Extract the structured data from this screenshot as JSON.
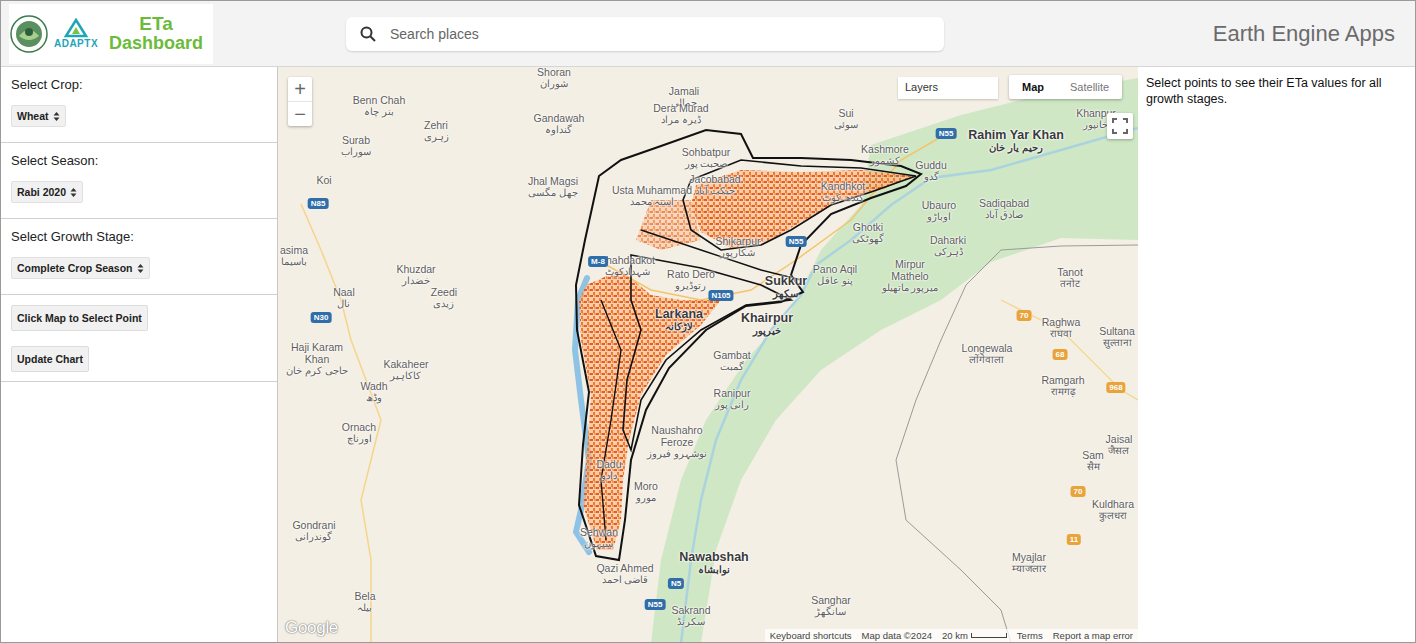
{
  "header": {
    "logo_text": "ADAPTX",
    "title_line1": "ETa",
    "title_line2": "Dashboard",
    "search": {
      "placeholder": "Search places"
    },
    "brand": "Earth Engine Apps"
  },
  "controls": [
    {
      "label": "Select Crop:",
      "value": "Wheat"
    },
    {
      "label": "Select Season:",
      "value": "Rabi 2020"
    },
    {
      "label": "Select Growth Stage:",
      "value": "Complete Crop Season"
    }
  ],
  "buttons": [
    "Click Map to Select Point",
    "Update Chart"
  ],
  "map": {
    "zoom_in": "+",
    "zoom_out": "−",
    "layers": "Layers",
    "map_types": [
      {
        "label": "Map",
        "selected": true
      },
      {
        "label": "Satellite",
        "selected": false
      }
    ],
    "places": [
      {
        "name": "Shoran",
        "native": "شوران"
      },
      {
        "name": "Jamali",
        "native": "جمالی"
      },
      {
        "name": "Dera Murad",
        "native": "ڈیرہ مراد"
      },
      {
        "name": "Benn Chah",
        "native": "بنر چاہ"
      },
      {
        "name": "Zehri",
        "native": "زہری"
      },
      {
        "name": "Surab",
        "native": "سوراب"
      },
      {
        "name": "Gandawah",
        "native": "گنداوہ"
      },
      {
        "name": "Sui",
        "native": "سوئی"
      },
      {
        "name": "Sohbatpur",
        "native": "صحبت پور"
      },
      {
        "name": "Khanpur",
        "native": "خانپور"
      },
      {
        "name": "Rahim Yar Khan",
        "native": "رحیم یار خان"
      },
      {
        "name": "Kashmore",
        "native": "کشمور"
      },
      {
        "name": "Koi",
        "native": ""
      },
      {
        "name": "Jhal Magsi",
        "native": "جھل مگسی"
      },
      {
        "name": "Jacobabad",
        "native": "جیکب آباد"
      },
      {
        "name": "Usta Muhammad",
        "native": "استہ محمد"
      },
      {
        "name": "Kandhkot",
        "native": "کندھ کوٹ"
      },
      {
        "name": "Guddu",
        "native": "گدو"
      },
      {
        "name": "Ubauro",
        "native": "اوباڑو"
      },
      {
        "name": "Sadiqabad",
        "native": "صادق آباد"
      },
      {
        "name": "Ghotki",
        "native": "گھوٹکی"
      },
      {
        "name": "Daharki",
        "native": "ڈہرکی"
      },
      {
        "name": "Shikarpur",
        "native": "شکارپور"
      },
      {
        "name": "asima",
        "native": "باسیما"
      },
      {
        "name": "Shahdadkot",
        "native": "شہدادکوٹ"
      },
      {
        "name": "Mirpur Mathelo",
        "native": "میرپور ماتھیلو"
      },
      {
        "name": "Pano Aqil",
        "native": "پنو عاقل"
      },
      {
        "name": "Khuzdar",
        "native": "خضدار"
      },
      {
        "name": "Tanot",
        "native": "तनोट"
      },
      {
        "name": "Rato Dero",
        "native": "رتوڈیرو"
      },
      {
        "name": "Sukkur",
        "native": "سکھر"
      },
      {
        "name": "Naal",
        "native": "نال"
      },
      {
        "name": "Zeedi",
        "native": "زیدی"
      },
      {
        "name": "Larkana",
        "native": "لاڑکانہ"
      },
      {
        "name": "Khairpur",
        "native": "خیرپور"
      },
      {
        "name": "Raghwa",
        "native": "राघवा"
      },
      {
        "name": "Sultana",
        "native": "सुल्ताना"
      },
      {
        "name": "Haji Karam Khan",
        "native": "حاجی کرم خان"
      },
      {
        "name": "Longewala",
        "native": "लोंगेवाला"
      },
      {
        "name": "Gambat",
        "native": "گمبت"
      },
      {
        "name": "Kakaheer",
        "native": "کاکاہیر"
      },
      {
        "name": "Ramgarh",
        "native": "रामगढ़"
      },
      {
        "name": "Wadh",
        "native": "وڈھ"
      },
      {
        "name": "Ranipur",
        "native": "رانی پور"
      },
      {
        "name": "Ornach",
        "native": "اورناچ"
      },
      {
        "name": "Naushahro Feroze",
        "native": "نوشہرو فیروز"
      },
      {
        "name": "Jaisal",
        "native": "जैसल"
      },
      {
        "name": "Sam",
        "native": "सैम"
      },
      {
        "name": "Dadu",
        "native": "دادو"
      },
      {
        "name": "Moro",
        "native": "مورو"
      },
      {
        "name": "Kuldhara",
        "native": "कुलधरा"
      },
      {
        "name": "Gondrani",
        "native": "گوندرانی"
      },
      {
        "name": "Sehwan",
        "native": "سیہون"
      },
      {
        "name": "Myajlar",
        "native": "म्याजलार"
      },
      {
        "name": "Nawabshah",
        "native": "نوابشاہ"
      },
      {
        "name": "Qazi Ahmed",
        "native": "قاضی احمد"
      },
      {
        "name": "Bela",
        "native": "بیلہ"
      },
      {
        "name": "Sanghar",
        "native": "سانگھڑ"
      },
      {
        "name": "Sakrand",
        "native": "سکرنڈ"
      }
    ],
    "shields": [
      "N85",
      "N30",
      "N55",
      "M-8",
      "N55",
      "N105",
      "N5",
      "N55",
      "70",
      "68",
      "968",
      "70",
      "11"
    ],
    "footer": {
      "logo": "Google",
      "shortcuts": "Keyboard shortcuts",
      "data": "Map data ©2024",
      "scale": "20 km",
      "terms": "Terms",
      "report": "Report a map error"
    }
  },
  "info": "Select points to see their ETa values for all growth stages."
}
